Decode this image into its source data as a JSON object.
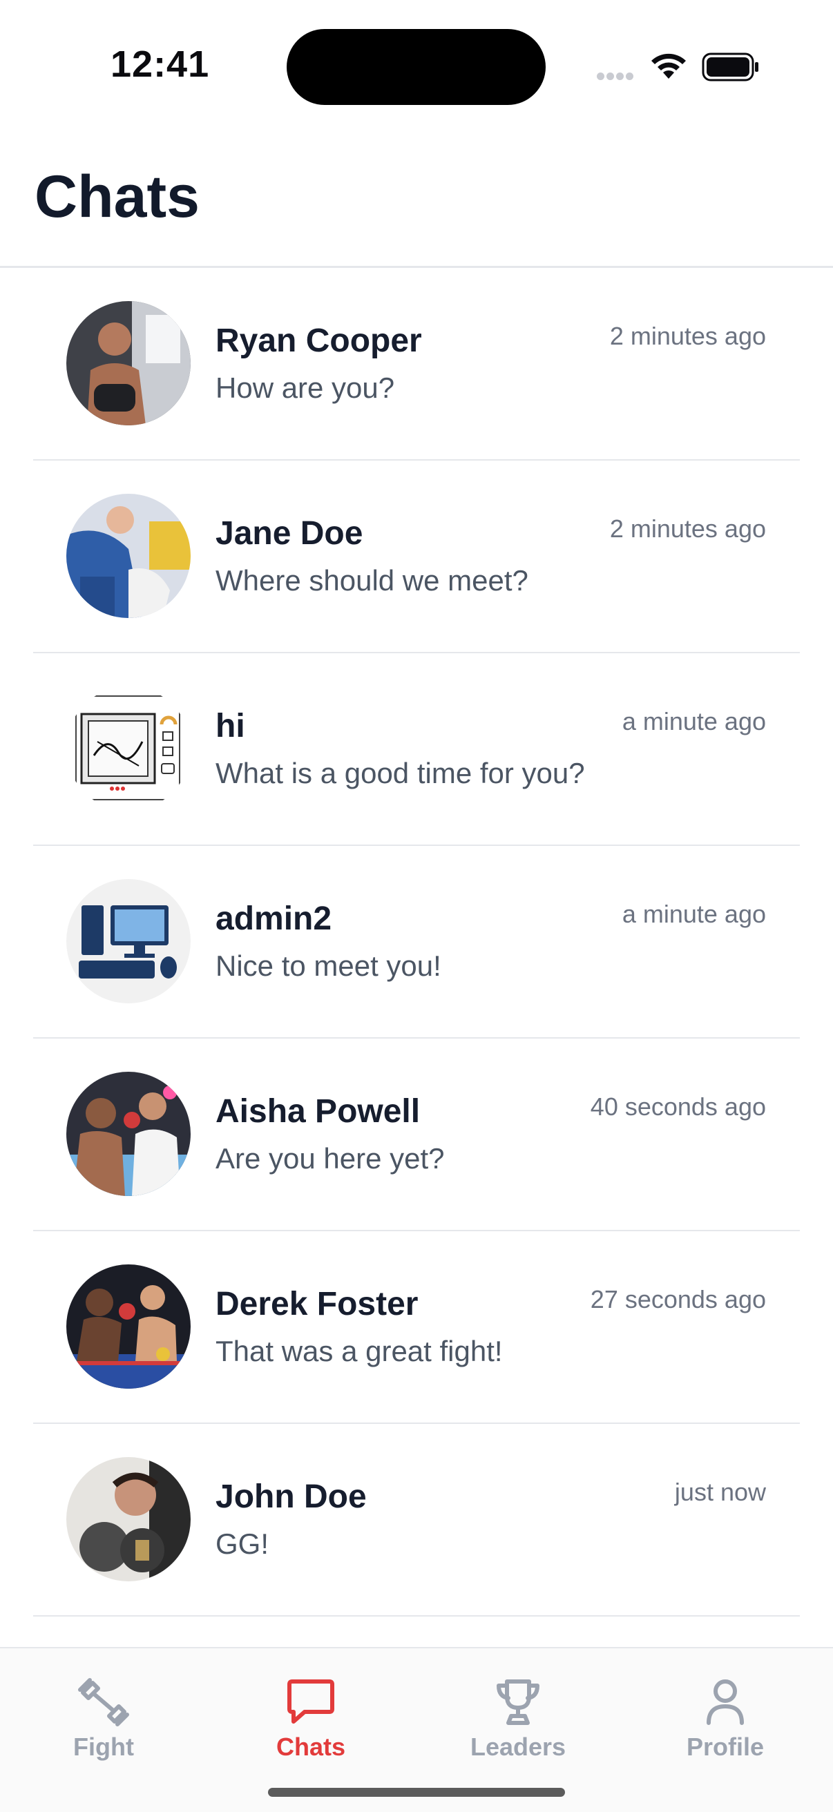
{
  "status_bar": {
    "time": "12:41"
  },
  "header": {
    "title": "Chats"
  },
  "chats": [
    {
      "name": "Ryan Cooper",
      "message": "How are you?",
      "time": "2 minutes ago",
      "avatar": "avatar-photo"
    },
    {
      "name": "Jane Doe",
      "message": "Where should we meet?",
      "time": "2 minutes ago",
      "avatar": "avatar-photo"
    },
    {
      "name": "hi",
      "message": "What is a good time for you?",
      "time": "a minute ago",
      "avatar": "avatar-illustration"
    },
    {
      "name": "admin2",
      "message": "Nice to meet you!",
      "time": "a minute ago",
      "avatar": "avatar-computer-illustration"
    },
    {
      "name": "Aisha Powell",
      "message": "Are you here yet?",
      "time": "40 seconds ago",
      "avatar": "avatar-photo"
    },
    {
      "name": "Derek Foster",
      "message": "That was a great fight!",
      "time": "27 seconds ago",
      "avatar": "avatar-photo"
    },
    {
      "name": "John Doe",
      "message": "GG!",
      "time": "just now",
      "avatar": "avatar-photo"
    }
  ],
  "tab_bar": {
    "tabs": [
      {
        "label": "Fight",
        "icon": "dumbbell-icon",
        "active": false
      },
      {
        "label": "Chats",
        "icon": "chat-bubble-icon",
        "active": true
      },
      {
        "label": "Leaders",
        "icon": "trophy-icon",
        "active": false
      },
      {
        "label": "Profile",
        "icon": "user-icon",
        "active": false
      }
    ]
  },
  "colors": {
    "accent": "#e23b3b",
    "inactive": "#9ca3af",
    "title": "#121a2b"
  }
}
